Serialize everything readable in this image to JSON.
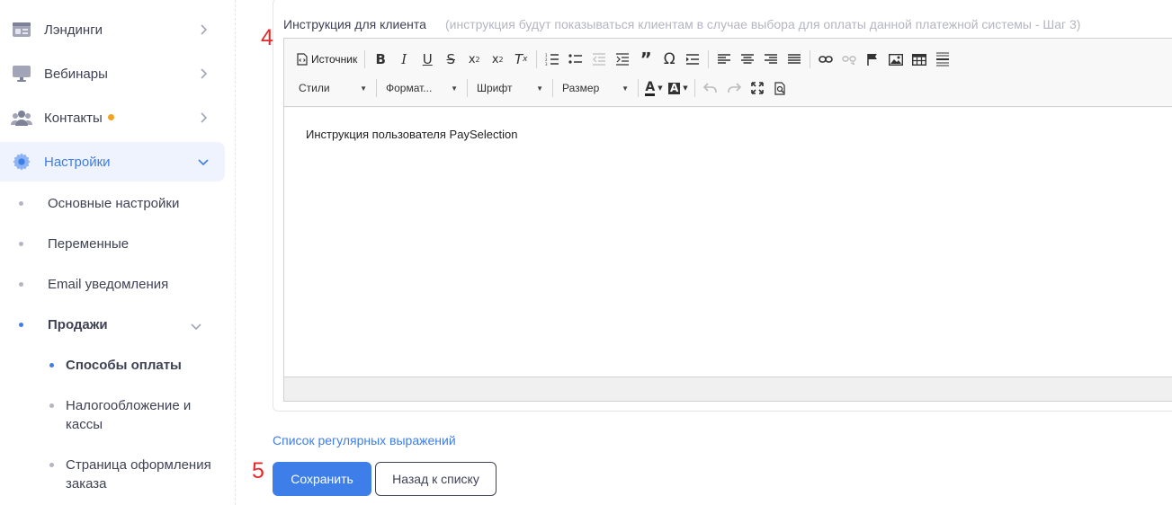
{
  "sidebar": {
    "items": [
      {
        "label": "Лэндинги",
        "icon": "landing-page-icon"
      },
      {
        "label": "Вебинары",
        "icon": "monitor-icon"
      },
      {
        "label": "Контакты",
        "icon": "users-icon",
        "badge": "notification-dot"
      },
      {
        "label": "Настройки",
        "icon": "gear-icon",
        "active": true
      }
    ],
    "sub_items": [
      {
        "label": "Основные настройки"
      },
      {
        "label": "Переменные"
      },
      {
        "label": "Email уведомления"
      },
      {
        "label": "Продажи"
      }
    ],
    "sales_sub_items": [
      {
        "label": "Способы оплаты"
      },
      {
        "label": "Налогообложение и кассы"
      },
      {
        "label": "Страница оформления заказа"
      }
    ]
  },
  "form": {
    "field_label": "Инструкция для клиента",
    "field_hint": "(инструкция будут показываться клиентам в случае выбора для оплаты данной платежной системы - Шаг 3)",
    "step_marker_4": "4",
    "step_marker_5": "5"
  },
  "editor": {
    "source_label": "Источник",
    "combos": {
      "styles": "Стили",
      "format": "Формат...",
      "font": "Шрифт",
      "size": "Размер"
    },
    "content": "Инструкция пользователя PaySelection"
  },
  "actions": {
    "regex_link": "Список регулярных выражений",
    "save_label": "Сохранить",
    "back_label": "Назад к списку"
  },
  "colors": {
    "accent": "#3e7ee8",
    "badge": "#f4a020",
    "marker": "#e32929"
  }
}
